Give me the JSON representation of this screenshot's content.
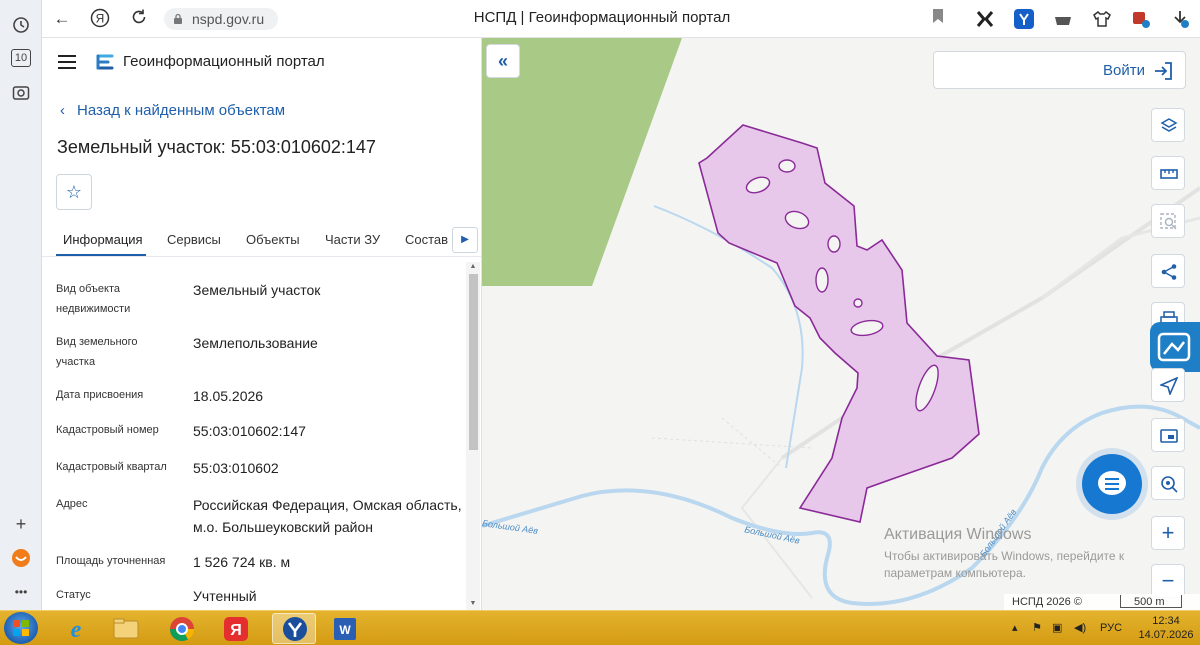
{
  "browser": {
    "url": "nspd.gov.ru",
    "title": "НСПД | Геоинформационный портал",
    "tabs_count": "10"
  },
  "panel": {
    "portal_name": "Геоинформационный портал",
    "back_label": "Назад к найденным объектам",
    "object_title": "Земельный участок: 55:03:010602:147",
    "tabs": [
      "Информация",
      "Сервисы",
      "Объекты",
      "Части ЗУ",
      "Состав"
    ],
    "rows": [
      {
        "label": "Вид объекта недвижимости",
        "value": "Земельный участок"
      },
      {
        "label": "Вид земельного участка",
        "value": "Землепользование"
      },
      {
        "label": "Дата присвоения",
        "value": "18.05.2026"
      },
      {
        "label": "Кадастровый номер",
        "value": "55:03:010602:147"
      },
      {
        "label": "Кадастровый квартал",
        "value": "55:03:010602"
      },
      {
        "label": "Адрес",
        "value": "Российская Федерация, Омская область, м.о. Большеуковский район"
      },
      {
        "label": "Площадь уточненная",
        "value": "1 526 724 кв. м"
      },
      {
        "label": "Статус",
        "value": "Учтенный"
      }
    ]
  },
  "map": {
    "login_label": "Войти",
    "river_label": "Большой Аёв",
    "watermark_title": "Активация Windows",
    "watermark_text": "Чтобы активировать Windows, перейдите к параметрам компьютера.",
    "copyright": "НСПД 2026 ©",
    "scale": "500 m",
    "colors": {
      "parcel_fill": "#e8c8ea",
      "parcel_stroke": "#8a2a98",
      "forest": "#a8ca86",
      "river": "#b9d7ef",
      "accent": "#1f5faa"
    }
  },
  "taskbar": {
    "lang": "РУС",
    "time": "12:34",
    "date": "14.07.2026"
  }
}
